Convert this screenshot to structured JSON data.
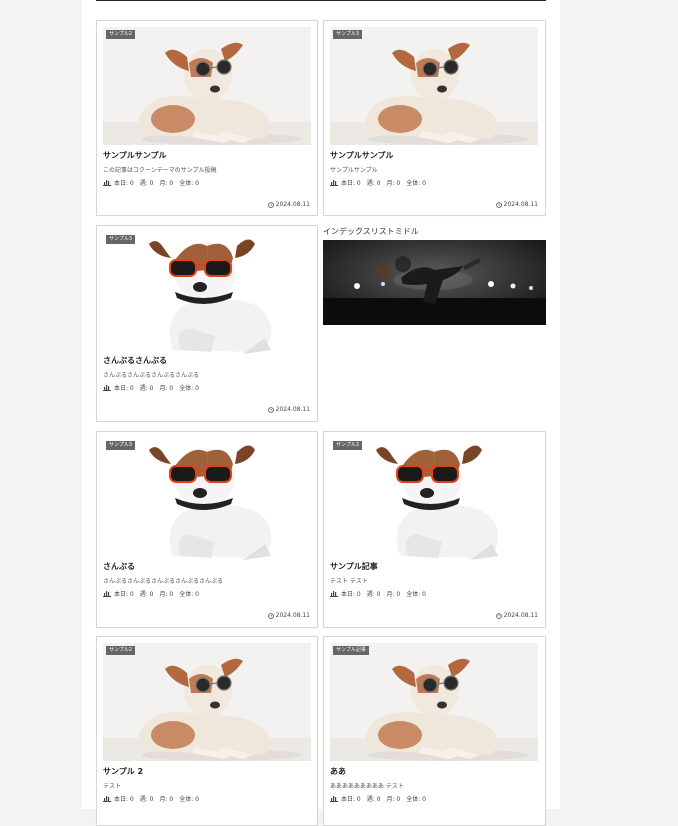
{
  "widget": {
    "title": "インデックスリストミドル",
    "image_alt": "american-football-player-image"
  },
  "posts": [
    {
      "category": "サンプル2",
      "title": "サンプルサンプル",
      "excerpt": "この記事はコクーンテーマのサンプル投稿",
      "stats": "本日: 0　週: 0　月: 0　全体: 0",
      "date": "2024.08.11",
      "image": "dog-sunglasses-small"
    },
    {
      "category": "サンプル3",
      "title": "サンプルサンプル",
      "excerpt": "サンプルサンプル",
      "stats": "本日: 0　週: 0　月: 0　全体: 0",
      "date": "2024.08.11",
      "image": "dog-sunglasses-small"
    },
    {
      "category": "サンプル3",
      "title": "さんぷるさんぷる",
      "excerpt": "さんぷるさんぷるさんぷるさんぷる",
      "stats": "本日: 0　週: 0　月: 0　全体: 0",
      "date": "2024.08.11",
      "image": "dog-red-sunglasses"
    },
    {
      "category": "サンプル3",
      "title": "さんぷる",
      "excerpt": "さんぷるさんぷるさんぷるさんぷるさんぷる",
      "stats": "本日: 0　週: 0　月: 0　全体: 0",
      "date": "2024.08.11",
      "image": "dog-red-sunglasses"
    },
    {
      "category": "サンプル2",
      "title": "サンプル記事",
      "excerpt": "テスト テスト",
      "stats": "本日: 0　週: 0　月: 0　全体: 0",
      "date": "2024.08.11",
      "image": "dog-red-sunglasses"
    },
    {
      "category": "サンプル2",
      "title": "サンプル 2",
      "excerpt": "テスト",
      "stats": "本日: 0　週: 0　月: 0　全体: 0",
      "date": "",
      "image": "dog-sunglasses-small"
    },
    {
      "category": "サンプル記事",
      "title": "ああ",
      "excerpt": "あああああああああ テスト",
      "stats": "本日: 0　週: 0　月: 0　全体: 0",
      "date": "",
      "image": "dog-sunglasses-small"
    }
  ],
  "colors": {
    "category_bg": "#666666",
    "border": "#d6d6d6"
  }
}
